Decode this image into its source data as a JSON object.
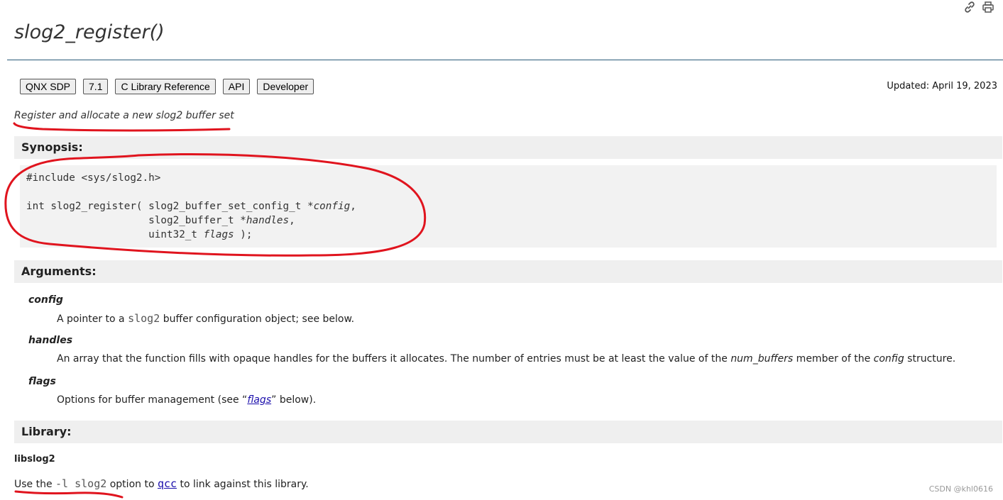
{
  "header": {
    "icons": [
      "link-icon",
      "print-icon"
    ],
    "title": "slog2_register()"
  },
  "badges": [
    {
      "label": "QNX SDP"
    },
    {
      "label": "7.1"
    },
    {
      "label": "C Library Reference"
    },
    {
      "label": "API"
    },
    {
      "label": "Developer"
    }
  ],
  "updated": "Updated: April 19, 2023",
  "short_description": "Register and allocate a new slog2 buffer set",
  "synopsis": {
    "heading": "Synopsis:",
    "include_line": "#include <sys/slog2.h>",
    "func_prefix": "int slog2_register( ",
    "param1_type": "slog2_buffer_set_config_t *",
    "param1_name": "config",
    "param2_type": "slog2_buffer_t *",
    "param2_name": "handles",
    "param3_type": "uint32_t ",
    "param3_name": "flags",
    "line_comma": ",",
    "func_suffix": " );"
  },
  "arguments": {
    "heading": "Arguments:",
    "config": {
      "term": "config",
      "desc_before": "A pointer to a ",
      "desc_code": "slog2",
      "desc_after": " buffer configuration object; see below."
    },
    "handles": {
      "term": "handles",
      "desc_before": "An array that the function fills with opaque handles for the buffers it allocates. The number of entries must be at least the value of the ",
      "desc_em1": "num_buffers",
      "desc_mid": " member of the ",
      "desc_em2": "config",
      "desc_after": " structure."
    },
    "flags": {
      "term": "flags",
      "desc_before": "Options for buffer management (see “",
      "desc_link": "flags",
      "desc_after": "” below)."
    }
  },
  "library": {
    "heading": "Library:",
    "name": "libslog2",
    "use_before": "Use the ",
    "use_code": "-l slog2",
    "use_mid": " option to ",
    "use_link": "qcc",
    "use_after": " to link against this library."
  },
  "watermark": "CSDN @khl0616",
  "annotation_color": "#e0141e"
}
